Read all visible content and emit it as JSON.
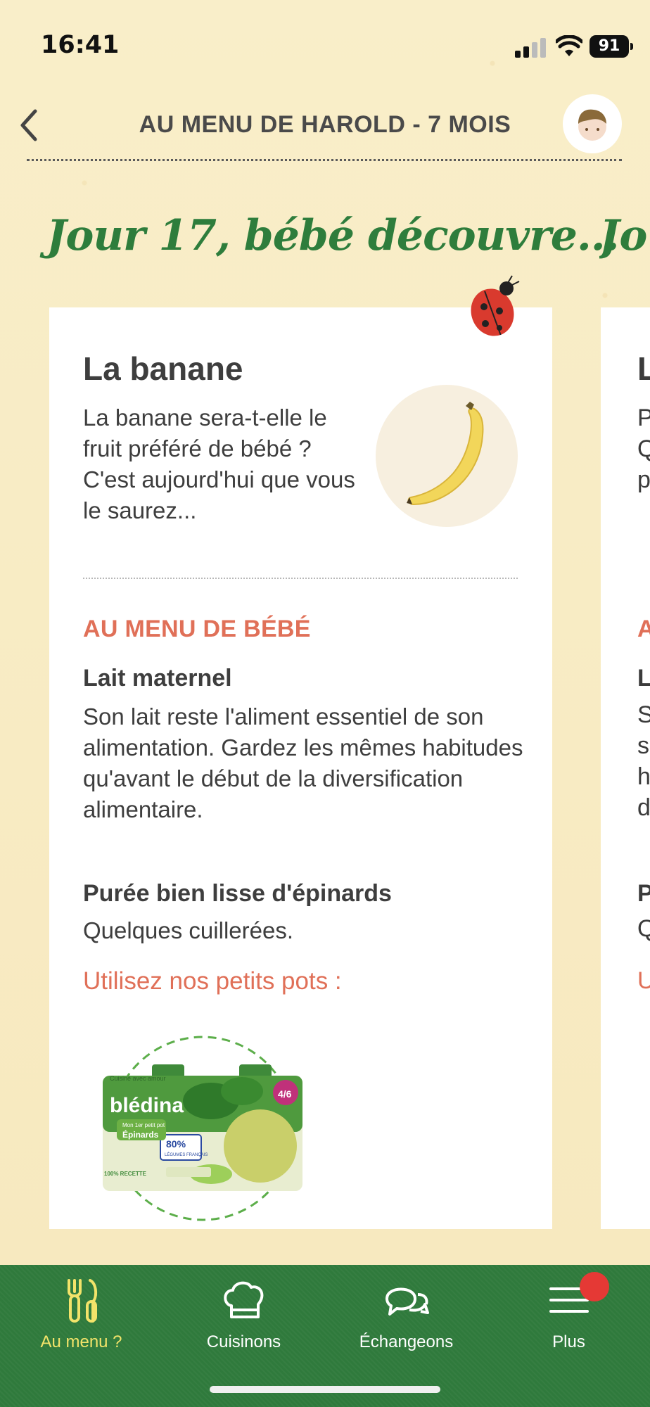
{
  "status_bar": {
    "time": "16:41",
    "battery": "91"
  },
  "header": {
    "title": "AU MENU DE HAROLD - 7 MOIS"
  },
  "day_title": "Jour 17, bébé découvre...",
  "day_title_peek": "Jo",
  "card": {
    "food_title": "La banane",
    "food_description": "La banane sera-t-elle le fruit préféré de bébé ? C'est aujourd'hui que vous le saurez...",
    "menu_heading": "AU MENU DE BÉBÉ",
    "items": [
      {
        "name": "Lait maternel",
        "description": "Son lait reste l'aliment essentiel de son alimentation. Gardez les mêmes habitudes qu'avant le début de la diversification alimentaire."
      },
      {
        "name": "Purée bien lisse d'épinards",
        "description": "Quelques cuillerées."
      }
    ],
    "use_products_link": "Utilisez nos petits pots :",
    "product": {
      "brand": "blédina",
      "tagline": "Cuisiné avec amour",
      "line1": "Mon 1er petit pot",
      "line2": "Épinards",
      "age": "4/6",
      "percent": "80%",
      "percent_caption": "LÉGUMES FRANÇAIS",
      "claim": "100% RECETTE"
    }
  },
  "card_peek_letters": [
    "L",
    "P",
    "Q",
    "p",
    "A",
    "L",
    "S",
    "s",
    "h",
    "d",
    "P",
    "Q",
    "U"
  ],
  "bottom_nav": [
    {
      "label": "Au menu ?",
      "icon": "fork-knife-icon",
      "active": true
    },
    {
      "label": "Cuisinons",
      "icon": "chef-hat-icon",
      "active": false
    },
    {
      "label": "Échangeons",
      "icon": "chat-bubbles-icon",
      "active": false
    },
    {
      "label": "Plus",
      "icon": "menu-icon",
      "active": false
    }
  ],
  "colors": {
    "accent_green": "#2e7d3c",
    "accent_coral": "#e07058",
    "active_nav": "#f2e36a",
    "badge": "#e53935"
  }
}
